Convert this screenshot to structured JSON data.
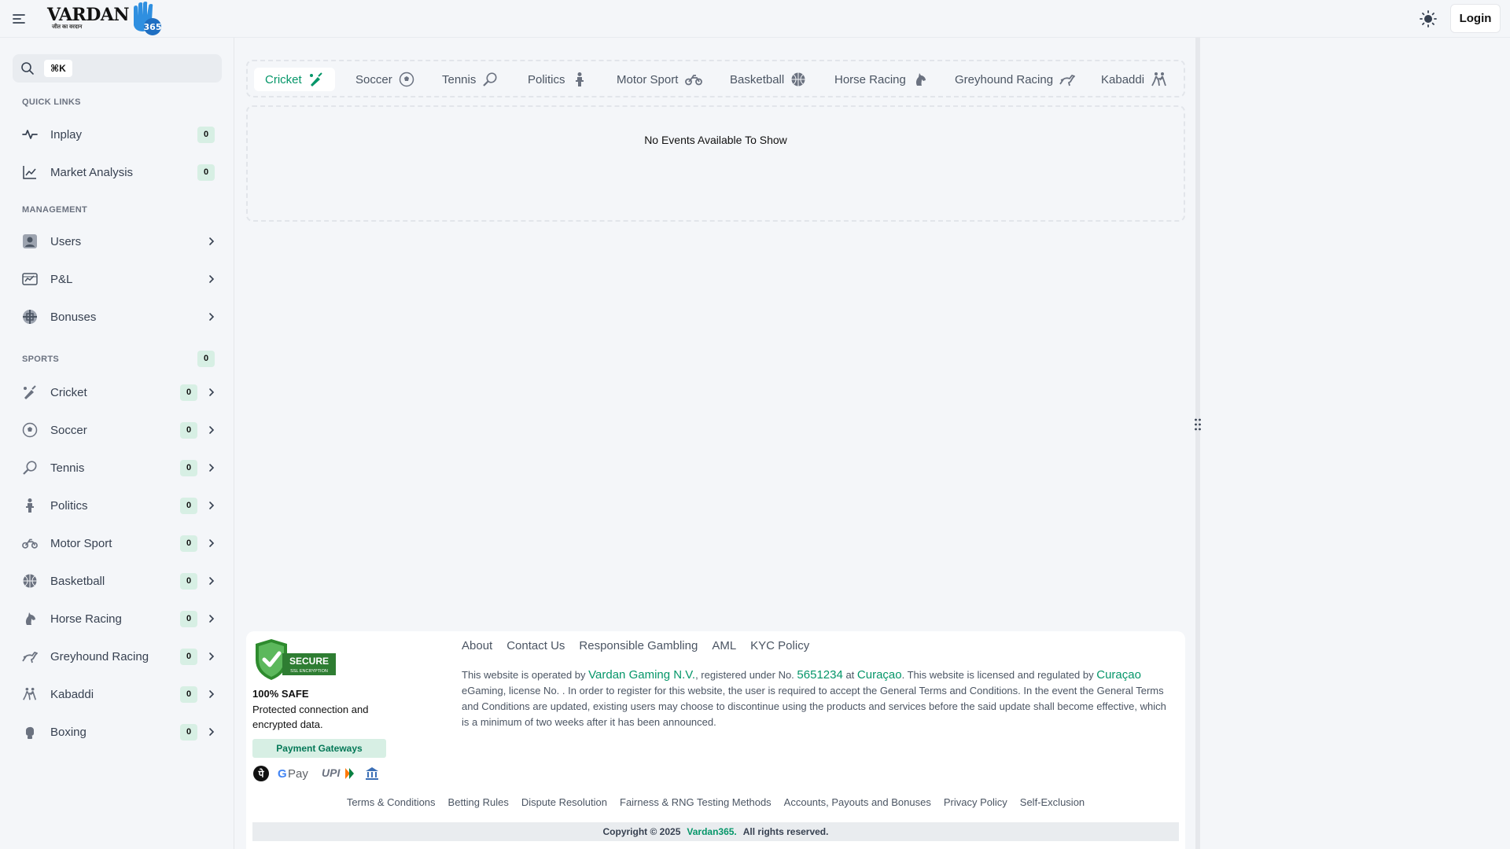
{
  "header": {
    "logo_text": "VARDAN",
    "logo_subtext": "जीत का वरदान",
    "logo_number": "365",
    "login_label": "Login"
  },
  "sidebar": {
    "search": {
      "shortcut": "⌘K",
      "placeholder": ""
    },
    "quick_links_title": "QUICK LINKS",
    "quick_links": [
      {
        "label": "Inplay",
        "count": "0"
      },
      {
        "label": "Market Analysis",
        "count": "0"
      }
    ],
    "management_title": "MANAGEMENT",
    "management": [
      {
        "label": "Users"
      },
      {
        "label": "P&L"
      },
      {
        "label": "Bonuses"
      }
    ],
    "sports_title": "SPORTS",
    "sports_count": "0",
    "sports": [
      {
        "label": "Cricket",
        "count": "0"
      },
      {
        "label": "Soccer",
        "count": "0"
      },
      {
        "label": "Tennis",
        "count": "0"
      },
      {
        "label": "Politics",
        "count": "0"
      },
      {
        "label": "Motor Sport",
        "count": "0"
      },
      {
        "label": "Basketball",
        "count": "0"
      },
      {
        "label": "Horse Racing",
        "count": "0"
      },
      {
        "label": "Greyhound Racing",
        "count": "0"
      },
      {
        "label": "Kabaddi",
        "count": "0"
      },
      {
        "label": "Boxing",
        "count": "0"
      }
    ]
  },
  "tabs": [
    {
      "label": "Cricket"
    },
    {
      "label": "Soccer"
    },
    {
      "label": "Tennis"
    },
    {
      "label": "Politics"
    },
    {
      "label": "Motor Sport"
    },
    {
      "label": "Basketball"
    },
    {
      "label": "Horse Racing"
    },
    {
      "label": "Greyhound Racing"
    },
    {
      "label": "Kabaddi"
    }
  ],
  "events": {
    "empty_message": "No Events Available To Show"
  },
  "footer": {
    "secure_badge": "SECURE",
    "secure_badge_sub": "SSL ENCRYPTION",
    "safe_title": "100% SAFE",
    "safe_desc": "Protected connection and encrypted data.",
    "payment_gateways": "Payment Gateways",
    "links": [
      "About",
      "Contact Us",
      "Responsible Gambling",
      "AML",
      "KYC Policy"
    ],
    "legal": {
      "p1": "This website is operated by ",
      "company": "Vardan Gaming N.V.",
      "p2": ", registered under No. ",
      "reg_no": "5651234",
      "p3": " at ",
      "place": "Curaçao",
      "p4": ". This website is licensed and regulated by ",
      "regulator": "Curaçao",
      "p5": " eGaming, license No. . In order to register for this website, the user is required to accept the General Terms and Conditions. In the event the General Terms and Conditions are updated, existing users may choose to discontinue using the products and services before the said update shall become effective, which is a minimum of two weeks after it has been announced."
    },
    "bottom_links": [
      "Terms & Conditions",
      "Betting Rules",
      "Dispute Resolution",
      "Fairness & RNG Testing Methods",
      "Accounts, Payouts and Bonuses",
      "Privacy Policy",
      "Self-Exclusion"
    ],
    "copyright": {
      "prefix": "Copyright © 2025",
      "brand": "Vardan365.",
      "suffix": "All rights reserved."
    }
  },
  "colors": {
    "accent": "#059669",
    "badge_bg": "#d7efe4",
    "page_bg": "#f4f6f9"
  }
}
